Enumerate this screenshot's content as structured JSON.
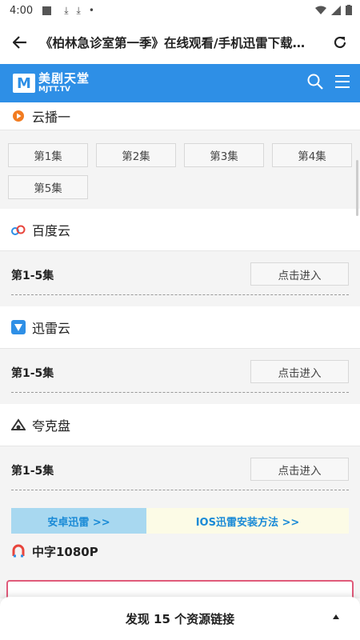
{
  "status_bar": {
    "time": "4:00"
  },
  "topbar": {
    "title": "《柏林急诊室第一季》在线观看/手机迅雷下载…"
  },
  "site": {
    "logo_cn": "美剧天堂",
    "logo_en": "MJTT.TV"
  },
  "cloud_play": {
    "title": "云播一",
    "episodes": [
      "第1集",
      "第2集",
      "第3集",
      "第4集",
      "第5集"
    ]
  },
  "baidu": {
    "title": "百度云",
    "range": "第1-5集",
    "button": "点击进入"
  },
  "xunlei": {
    "title": "迅雷云",
    "range": "第1-5集",
    "button": "点击进入"
  },
  "quark": {
    "title": "夸克盘",
    "range": "第1-5集",
    "button": "点击进入"
  },
  "ads": {
    "left": "安卓迅雷 >>",
    "right": "IOS迅雷安装方法 >>"
  },
  "quality": {
    "label": "中字1080P"
  },
  "bottom_sheet": {
    "text": "发现 15 个资源链接"
  },
  "colors": {
    "accent": "#2e8fe6",
    "play_icon": "#f27c21",
    "ad_left_bg": "#a8d8f0",
    "ad_right_bg": "#fcfbe6",
    "link": "#1a8ad6"
  }
}
